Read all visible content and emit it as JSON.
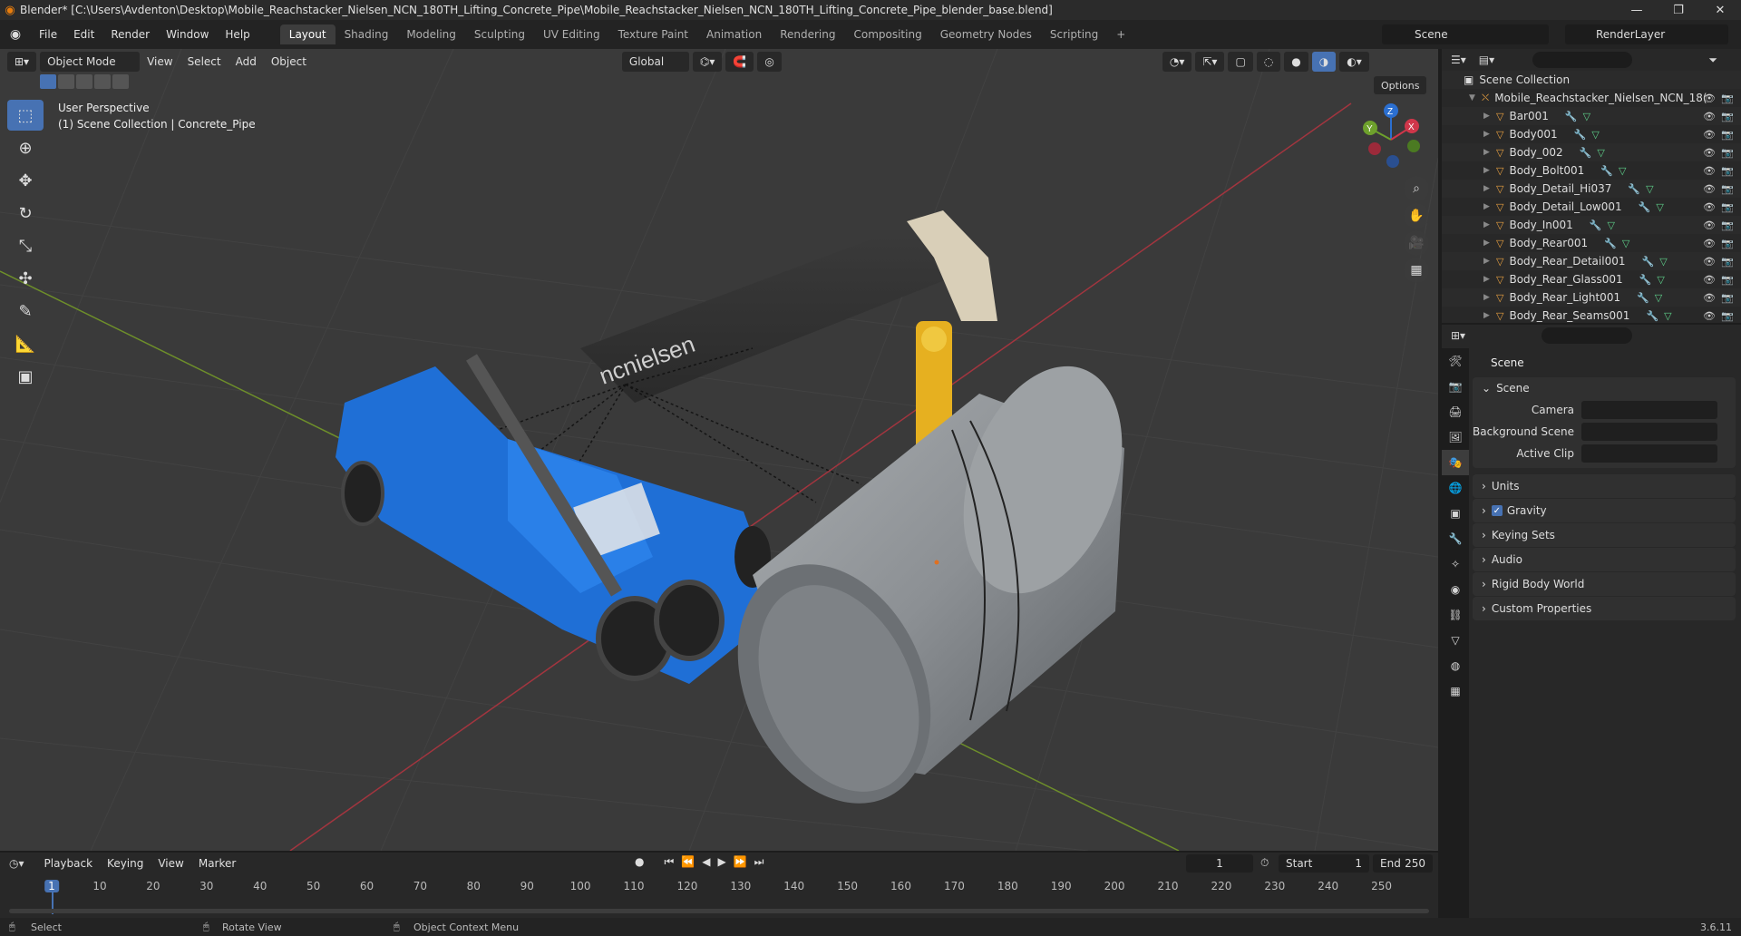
{
  "window": {
    "title": "Blender* [C:\\Users\\Avdenton\\Desktop\\Mobile_Reachstacker_Nielsen_NCN_180TH_Lifting_Concrete_Pipe\\Mobile_Reachstacker_Nielsen_NCN_180TH_Lifting_Concrete_Pipe_blender_base.blend]",
    "minimize": "—",
    "maximize": "❐",
    "close": "✕"
  },
  "menu": [
    "File",
    "Edit",
    "Render",
    "Window",
    "Help"
  ],
  "workspaces": [
    "Layout",
    "Shading",
    "Modeling",
    "Sculpting",
    "UV Editing",
    "Texture Paint",
    "Animation",
    "Rendering",
    "Compositing",
    "Geometry Nodes",
    "Scripting"
  ],
  "workspace_add": "+",
  "scene_name": "Scene",
  "render_layer": "RenderLayer",
  "viewport": {
    "mode": "Object Mode",
    "menus": [
      "View",
      "Select",
      "Add",
      "Object"
    ],
    "orientation": "Global",
    "options_label": "Options",
    "info_line1": "User Perspective",
    "info_line2": "(1) Scene Collection | Concrete_Pipe",
    "boom_text": "ncnielsen",
    "gizmo": {
      "x": "X",
      "y": "Y",
      "z": "Z"
    }
  },
  "outliner": {
    "root": "Scene Collection",
    "collection": "Mobile_Reachstacker_Nielsen_NCN_18(",
    "items": [
      "Bar001",
      "Body001",
      "Body_002",
      "Body_Bolt001",
      "Body_Detail_Hi037",
      "Body_Detail_Low001",
      "Body_In001",
      "Body_Rear001",
      "Body_Rear_Detail001",
      "Body_Rear_Glass001",
      "Body_Rear_Light001",
      "Body_Rear_Seams001"
    ]
  },
  "properties": {
    "header": "Scene",
    "panel": "Scene",
    "fields": [
      {
        "label": "Camera",
        "value": ""
      },
      {
        "label": "Background Scene",
        "value": ""
      },
      {
        "label": "Active Clip",
        "value": ""
      }
    ],
    "subpanels": [
      "Units",
      "Gravity",
      "Keying Sets",
      "Audio",
      "Rigid Body World",
      "Custom Properties"
    ]
  },
  "timeline": {
    "menus": [
      "Playback",
      "Keying",
      "View",
      "Marker"
    ],
    "current_frame": "1",
    "start_label": "Start",
    "start": "1",
    "end_label": "End",
    "end": "250",
    "ruler": [
      "1",
      "10",
      "20",
      "30",
      "40",
      "50",
      "60",
      "70",
      "80",
      "90",
      "100",
      "110",
      "120",
      "130",
      "140",
      "150",
      "160",
      "170",
      "180",
      "190",
      "200",
      "210",
      "220",
      "230",
      "240",
      "250"
    ]
  },
  "status": {
    "select": "Select",
    "rotate": "Rotate View",
    "context": "Object Context Menu",
    "version": "3.6.11"
  },
  "colors": {
    "accent": "#4772b3",
    "reachstacker": "#1f6fd6",
    "hook": "#e6b020",
    "pipe": "#8c8f92"
  }
}
